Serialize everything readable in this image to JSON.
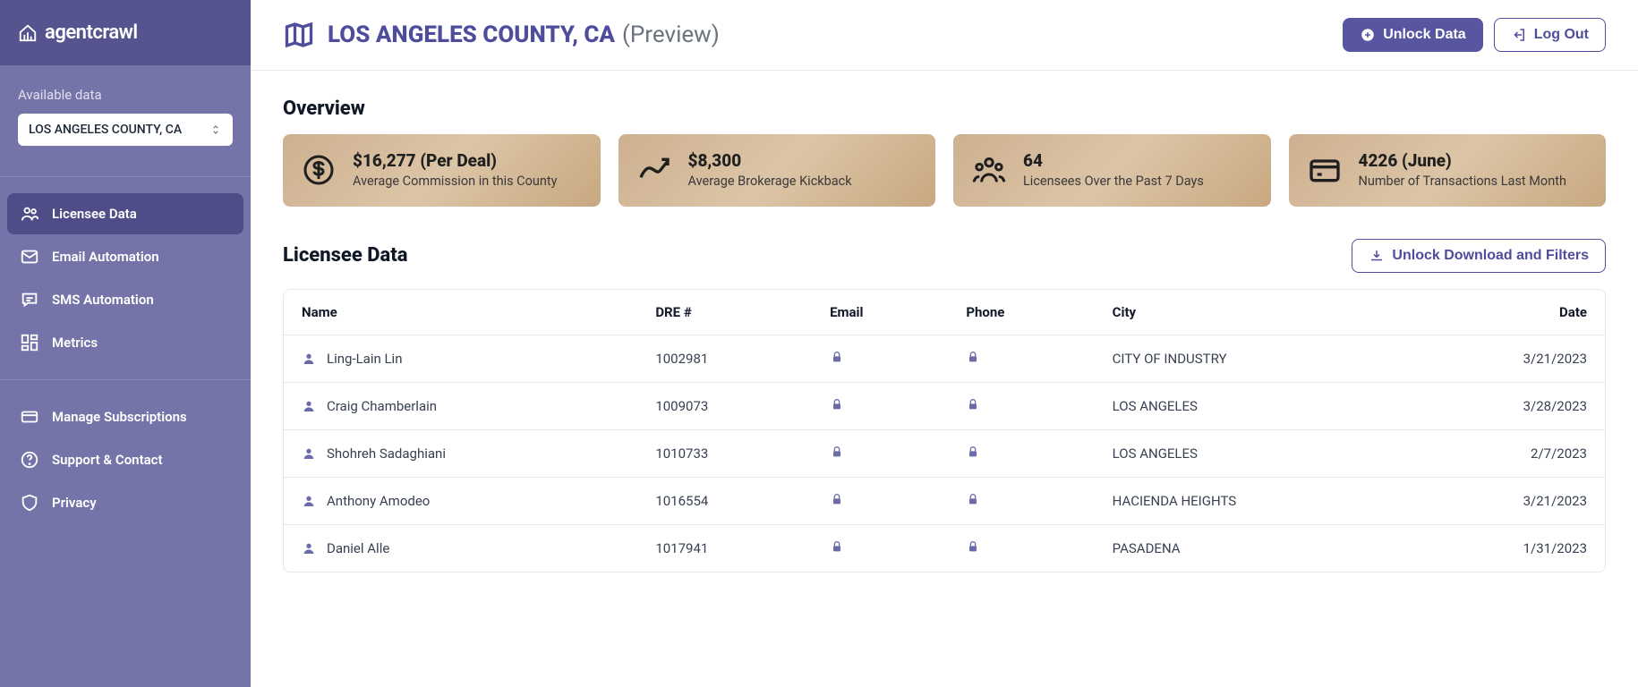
{
  "brand": "agentcrawl",
  "sidebar": {
    "available_label": "Available data",
    "selected_county": "LOS ANGELES COUNTY, CA",
    "nav_primary": [
      {
        "label": "Licensee Data",
        "icon": "users-icon",
        "active": true
      },
      {
        "label": "Email Automation",
        "icon": "mail-icon",
        "active": false
      },
      {
        "label": "SMS Automation",
        "icon": "message-icon",
        "active": false
      },
      {
        "label": "Metrics",
        "icon": "dashboard-icon",
        "active": false
      }
    ],
    "nav_secondary": [
      {
        "label": "Manage Subscriptions",
        "icon": "card-icon"
      },
      {
        "label": "Support & Contact",
        "icon": "help-icon"
      },
      {
        "label": "Privacy",
        "icon": "shield-icon"
      }
    ]
  },
  "header": {
    "title": "LOS ANGELES COUNTY, CA",
    "suffix": "(Preview)",
    "unlock_label": "Unlock Data",
    "logout_label": "Log Out"
  },
  "overview": {
    "title": "Overview",
    "cards": [
      {
        "value": "$16,277 (Per Deal)",
        "label": "Average Commission in this County",
        "icon": "dollar-icon"
      },
      {
        "value": "$8,300",
        "label": "Average Brokerage Kickback",
        "icon": "trend-icon"
      },
      {
        "value": "64",
        "label": "Licensees Over the Past 7 Days",
        "icon": "group-icon"
      },
      {
        "value": "4226 (June)",
        "label": "Number of Transactions Last Month",
        "icon": "card2-icon"
      }
    ]
  },
  "licensee": {
    "title": "Licensee Data",
    "unlock_btn": "Unlock Download and Filters",
    "columns": [
      "Name",
      "DRE #",
      "Email",
      "Phone",
      "City",
      "Date"
    ],
    "rows": [
      {
        "name": "Ling-Lain Lin",
        "dre": "1002981",
        "city": "CITY OF INDUSTRY",
        "date": "3/21/2023"
      },
      {
        "name": "Craig Chamberlain",
        "dre": "1009073",
        "city": "LOS ANGELES",
        "date": "3/28/2023"
      },
      {
        "name": "Shohreh Sadaghiani",
        "dre": "1010733",
        "city": "LOS ANGELES",
        "date": "2/7/2023"
      },
      {
        "name": "Anthony Amodeo",
        "dre": "1016554",
        "city": "HACIENDA HEIGHTS",
        "date": "3/21/2023"
      },
      {
        "name": "Daniel Alle",
        "dre": "1017941",
        "city": "PASADENA",
        "date": "1/31/2023"
      }
    ]
  }
}
